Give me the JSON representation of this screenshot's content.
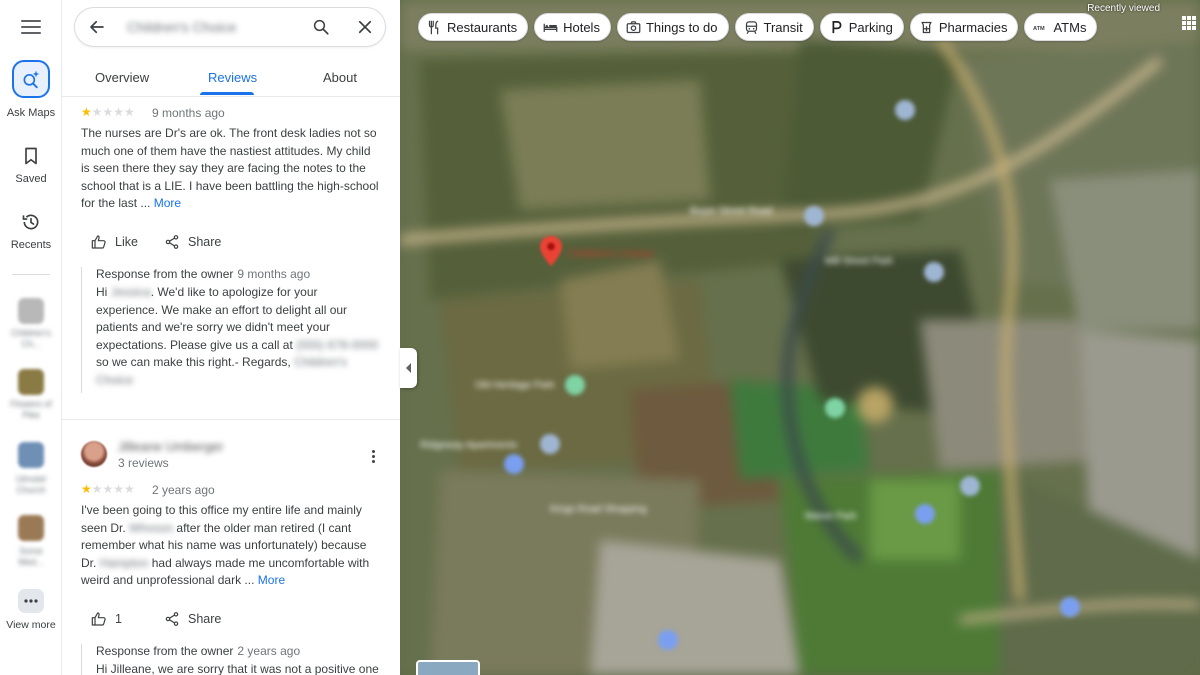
{
  "rail": {
    "ask_maps": "Ask Maps",
    "saved": "Saved",
    "recents": "Recents",
    "recent_items": [
      {
        "label": "Children's Ch...",
        "color": "#b8b8b8"
      },
      {
        "label": "Flowers of Pike",
        "color": "#8a7b45"
      },
      {
        "label": "Ulmstel Church",
        "color": "#6f8fb5"
      },
      {
        "label": "Some Med...",
        "color": "#9a7a55"
      }
    ],
    "view_more": "View more"
  },
  "search": {
    "query": "Children's Choice"
  },
  "tabs": [
    {
      "label": "Overview"
    },
    {
      "label": "Reviews"
    },
    {
      "label": "About"
    }
  ],
  "reviews": [
    {
      "rating": 1,
      "when": "9 months ago",
      "text": "The nurses are Dr's are ok. The front desk ladies not so much one of them have the nastiest attitudes. My child is seen there they say they are facing the notes to the school that is a LIE. I have been battling the high-school for the last ...",
      "more": "More",
      "like": "Like",
      "share": "Share",
      "owner_response": {
        "label": "Response from the owner",
        "when": "9 months ago",
        "greeting": "Hi",
        "name_redacted": "Jessica",
        "text1": ". We'd like to apologize for your experience. We make an effort to delight all our patients and we're sorry we didn't meet your expectations. Please give us a call at",
        "phone_redacted": "(555) 678-0000",
        "text2": "so we can make this right.- Regards,",
        "signature_redacted": "Children's Choice"
      }
    },
    {
      "reviewer": "Jilleane Umberger",
      "review_count": "3 reviews",
      "rating": 1,
      "when": "2 years ago",
      "text_a": "I've been going to this office my entire life and mainly seen Dr.",
      "name1": "Whoson",
      "text_b": "after the older man retired (I cant remember what his name was unfortunately) because Dr.",
      "name2": "Hampton",
      "text_c": "had always made me uncomfortable with weird and unprofessional dark ...",
      "more": "More",
      "likes": "1",
      "share": "Share",
      "owner_response": {
        "label": "Response from the owner",
        "when": "2 years ago",
        "text": "Hi Jilleane, we are sorry that it was not a positive one"
      }
    }
  ],
  "map": {
    "chips": [
      {
        "label": "Restaurants",
        "icon": "fork-knife-icon"
      },
      {
        "label": "Hotels",
        "icon": "bed-icon"
      },
      {
        "label": "Things to do",
        "icon": "camera-icon"
      },
      {
        "label": "Transit",
        "icon": "train-icon"
      },
      {
        "label": "Parking",
        "icon": "parking-icon"
      },
      {
        "label": "Pharmacies",
        "icon": "pharmacy-icon"
      },
      {
        "label": "ATMs",
        "icon": "atm-icon"
      }
    ],
    "recently_viewed": "Recently viewed",
    "pin_label": "Children's Choice",
    "labels": [
      "Boyer Street Road",
      "Mill Street Park",
      "Old Heritage Park",
      "Ridgeway Apartments",
      "Kings Road Shopping",
      "Manor Park"
    ]
  },
  "colors": {
    "accent": "#1a73e8",
    "star": "#fbbc04",
    "pin": "#ea4335"
  }
}
